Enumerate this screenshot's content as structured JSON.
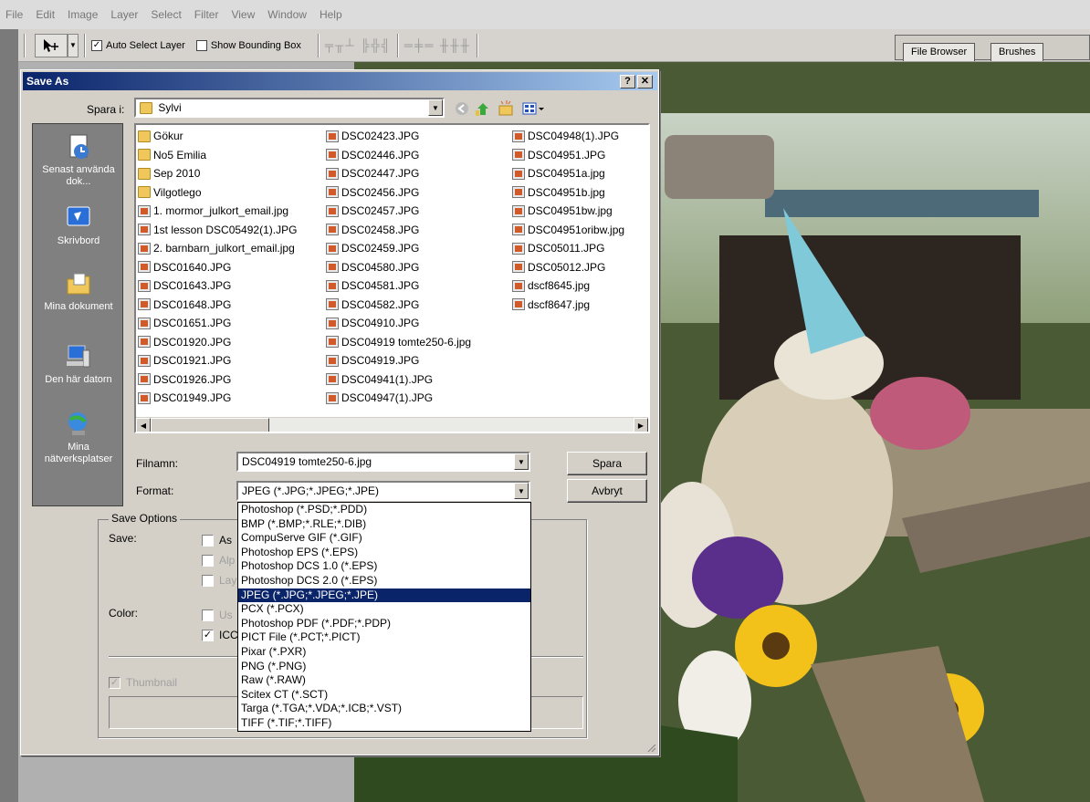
{
  "menubar": {
    "items": [
      "File",
      "Edit",
      "Image",
      "Layer",
      "Select",
      "Filter",
      "View",
      "Window",
      "Help"
    ]
  },
  "options_bar": {
    "auto_select_layer": {
      "label": "Auto Select Layer",
      "checked": true
    },
    "show_bounding_box": {
      "label": "Show Bounding Box",
      "checked": false
    },
    "tool_icon": "move-tool-icon"
  },
  "panel_well": {
    "tabs": [
      "File Browser",
      "Brushes"
    ]
  },
  "dialog": {
    "title": "Save As",
    "help_btn": "?",
    "close_btn": "✕",
    "save_in_label": "Spara i:",
    "save_in_value": "Sylvi",
    "places": [
      {
        "label": "Senast använda dok...",
        "icon": "recent-documents-icon"
      },
      {
        "label": "Skrivbord",
        "icon": "desktop-icon"
      },
      {
        "label": "Mina dokument",
        "icon": "my-documents-icon"
      },
      {
        "label": "Den här datorn",
        "icon": "my-computer-icon"
      },
      {
        "label": "Mina nätverksplatser",
        "icon": "network-places-icon"
      }
    ],
    "files": {
      "col1": [
        {
          "name": "Gökur",
          "type": "folder"
        },
        {
          "name": "No5 Emilia",
          "type": "folder"
        },
        {
          "name": "Sep 2010",
          "type": "folder"
        },
        {
          "name": "Vilgotlego",
          "type": "folder"
        },
        {
          "name": "1. mormor_julkort_email.jpg",
          "type": "jpg"
        },
        {
          "name": "1st lesson DSC05492(1).JPG",
          "type": "jpg"
        },
        {
          "name": "2. barnbarn_julkort_email.jpg",
          "type": "jpg"
        },
        {
          "name": "DSC01640.JPG",
          "type": "jpg"
        },
        {
          "name": "DSC01643.JPG",
          "type": "jpg"
        },
        {
          "name": "DSC01648.JPG",
          "type": "jpg"
        },
        {
          "name": "DSC01651.JPG",
          "type": "jpg"
        },
        {
          "name": "DSC01920.JPG",
          "type": "jpg"
        },
        {
          "name": "DSC01921.JPG",
          "type": "jpg"
        },
        {
          "name": "DSC01926.JPG",
          "type": "jpg"
        },
        {
          "name": "DSC01949.JPG",
          "type": "jpg"
        }
      ],
      "col2": [
        {
          "name": "DSC02423.JPG",
          "type": "jpg"
        },
        {
          "name": "DSC02446.JPG",
          "type": "jpg"
        },
        {
          "name": "DSC02447.JPG",
          "type": "jpg"
        },
        {
          "name": "DSC02456.JPG",
          "type": "jpg"
        },
        {
          "name": "DSC02457.JPG",
          "type": "jpg"
        },
        {
          "name": "DSC02458.JPG",
          "type": "jpg"
        },
        {
          "name": "DSC02459.JPG",
          "type": "jpg"
        },
        {
          "name": "DSC04580.JPG",
          "type": "jpg"
        },
        {
          "name": "DSC04581.JPG",
          "type": "jpg"
        },
        {
          "name": "DSC04582.JPG",
          "type": "jpg"
        },
        {
          "name": "DSC04910.JPG",
          "type": "jpg"
        },
        {
          "name": "DSC04919 tomte250-6.jpg",
          "type": "jpg"
        },
        {
          "name": "DSC04919.JPG",
          "type": "jpg"
        },
        {
          "name": "DSC04941(1).JPG",
          "type": "jpg"
        },
        {
          "name": "DSC04947(1).JPG",
          "type": "jpg"
        }
      ],
      "col3": [
        {
          "name": "DSC04948(1).JPG",
          "type": "jpg"
        },
        {
          "name": "DSC04951.JPG",
          "type": "jpg"
        },
        {
          "name": "DSC04951a.jpg",
          "type": "jpg"
        },
        {
          "name": "DSC04951b.jpg",
          "type": "jpg"
        },
        {
          "name": "DSC04951bw.jpg",
          "type": "jpg"
        },
        {
          "name": "DSC04951oribw.jpg",
          "type": "jpg"
        },
        {
          "name": "DSC05011.JPG",
          "type": "jpg"
        },
        {
          "name": "DSC05012.JPG",
          "type": "jpg"
        },
        {
          "name": "dscf8645.jpg",
          "type": "jpg"
        },
        {
          "name": "dscf8647.jpg",
          "type": "jpg"
        }
      ]
    },
    "filename_label": "Filnamn:",
    "filename_value": "DSC04919 tomte250-6.jpg",
    "format_label": "Format:",
    "format_value": "JPEG (*.JPG;*.JPEG;*.JPE)",
    "save_button": "Spara",
    "cancel_button": "Avbryt",
    "save_options": {
      "title": "Save Options",
      "save_label": "Save:",
      "color_label": "Color:",
      "as_copy": "As",
      "alpha": "Alp",
      "layers": "Lay",
      "use_proof": "Us",
      "icc": "ICC",
      "thumbnail": "Thumbnail"
    },
    "format_options": [
      "Photoshop (*.PSD;*.PDD)",
      "BMP (*.BMP;*.RLE;*.DIB)",
      "CompuServe GIF (*.GIF)",
      "Photoshop EPS (*.EPS)",
      "Photoshop DCS 1.0 (*.EPS)",
      "Photoshop DCS 2.0 (*.EPS)",
      "JPEG (*.JPG;*.JPEG;*.JPE)",
      "PCX (*.PCX)",
      "Photoshop PDF (*.PDF;*.PDP)",
      "PICT File (*.PCT;*.PICT)",
      "Pixar (*.PXR)",
      "PNG (*.PNG)",
      "Raw (*.RAW)",
      "Scitex CT (*.SCT)",
      "Targa (*.TGA;*.VDA;*.ICB;*.VST)",
      "TIFF (*.TIF;*.TIFF)"
    ],
    "selected_format_index": 6
  },
  "colors": {
    "title_start": "#0a246a",
    "title_end": "#a6caf0",
    "selection": "#0a246a",
    "dialog_face": "#d4d0c8"
  }
}
